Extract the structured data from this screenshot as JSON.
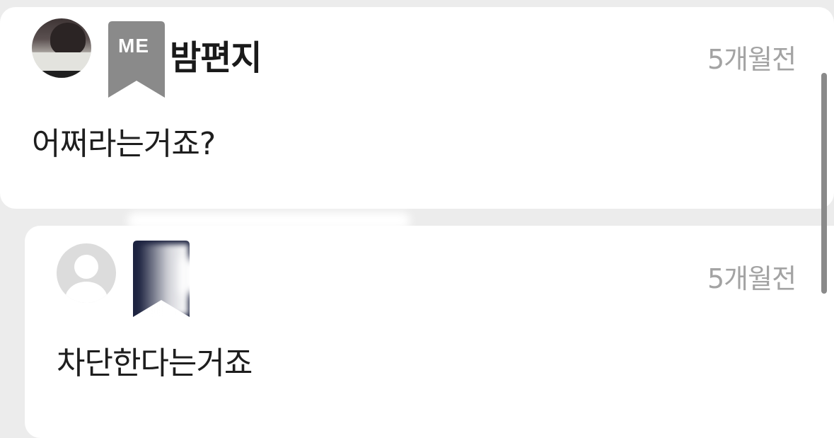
{
  "comments": [
    {
      "badge": "ME",
      "username": "밤편지",
      "time": "5개월전",
      "text": "어쩌라는거죠?",
      "badge_color": "#8a8a8a"
    },
    {
      "time": "5개월전",
      "text": "차단한다는거죠",
      "badge_color": "#1d2340"
    }
  ],
  "colors": {
    "background": "#ececec",
    "card": "#ffffff",
    "timestamp": "#a3a3a3",
    "scrollbar": "#8a8a8a"
  },
  "icons": {
    "avatar_default": "user-silhouette-icon",
    "badge": "bookmark-ribbon-icon"
  }
}
